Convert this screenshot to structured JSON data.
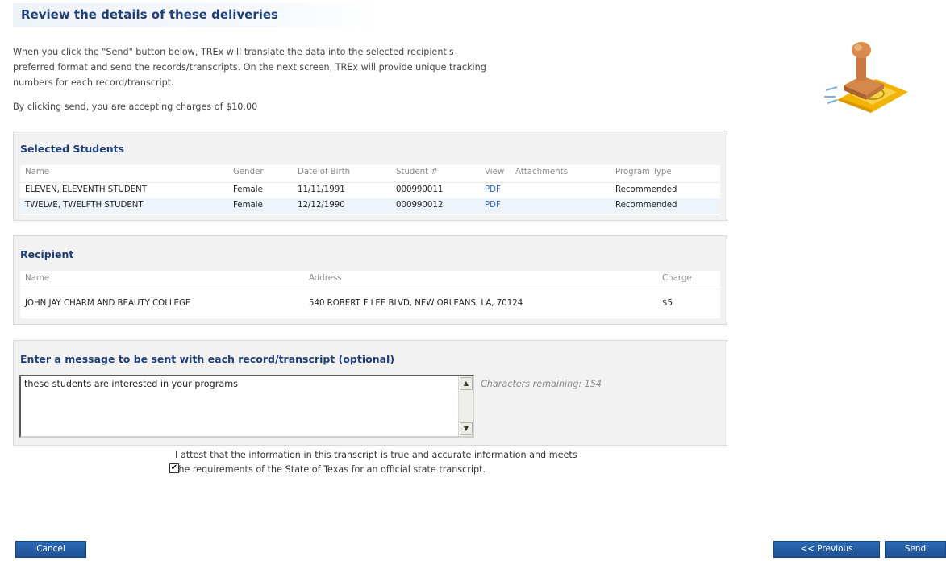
{
  "header": {
    "title": "Review the details of these deliveries"
  },
  "intro": {
    "line1": "When you click the \"Send\" button below, TREx will translate the data into the selected recipient's",
    "line2": "preferred format and send the records/transcripts. On the next screen, TREx will provide unique tracking",
    "line3": "numbers for each record/transcript.",
    "charges": "By clicking send, you are accepting charges of $10.00"
  },
  "students": {
    "title": "Selected Students",
    "columns": [
      "Name",
      "Gender",
      "Date of Birth",
      "Student #",
      "View",
      "Attachments",
      "Program Type"
    ],
    "rows": [
      {
        "name": "ELEVEN, ELEVENTH STUDENT",
        "gender": "Female",
        "dob": "11/11/1991",
        "student_no": "000990011",
        "view": "PDF",
        "attachments": "",
        "program": "Recommended"
      },
      {
        "name": "TWELVE, TWELFTH STUDENT",
        "gender": "Female",
        "dob": "12/12/1990",
        "student_no": "000990012",
        "view": "PDF",
        "attachments": "",
        "program": "Recommended"
      }
    ]
  },
  "recipient": {
    "title": "Recipient",
    "columns": [
      "Name",
      "Address",
      "Charge"
    ],
    "row": {
      "name": "JOHN JAY CHARM AND BEAUTY COLLEGE",
      "address": "540 ROBERT E LEE BLVD, NEW ORLEANS, LA, 70124",
      "charge": "$5"
    }
  },
  "message": {
    "title": "Enter a message to be sent with each record/transcript (optional)",
    "value": "these students are interested in your programs",
    "chars_remaining": "Characters remaining: 154"
  },
  "attest": {
    "line1": "I attest that the information in this transcript is true and accurate information and meets",
    "line2": "the requirements of the State of Texas for an official state transcript.",
    "checked": true
  },
  "buttons": {
    "cancel": "Cancel",
    "previous": "<< Previous",
    "send": "Send"
  },
  "colors": {
    "title": "#1f3f76",
    "link": "#2f65c2",
    "button": "#2261a8",
    "panel": "#f2f2f2"
  },
  "icons": {
    "stamp": "stamp-illustration-icon",
    "scroll_up": "scroll-up-icon",
    "scroll_down": "scroll-down-icon",
    "check": "checkmark-icon"
  }
}
